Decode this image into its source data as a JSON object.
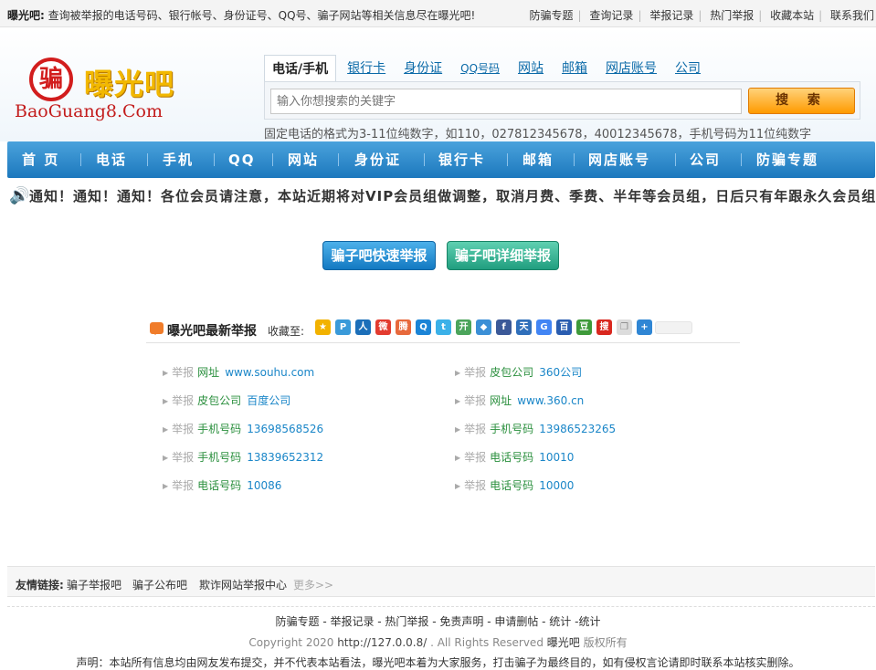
{
  "topbar": {
    "intro_bold": "曝光吧:",
    "intro_text": "查询被举报的电话号码、银行帐号、身份证号、QQ号、骗子网站等相关信息尽在曝光吧!",
    "links": [
      "防骗专题",
      "查询记录",
      "举报记录",
      "热门举报",
      "收藏本站",
      "联系我们"
    ]
  },
  "logo": {
    "badge": "骗",
    "name": "曝光吧",
    "domain": "BaoGuang8.Com"
  },
  "search": {
    "tabs": [
      "电话/手机",
      "银行卡",
      "身份证",
      "QQ号码",
      "网站",
      "邮箱",
      "网店账号",
      "公司"
    ],
    "active_tab": 0,
    "placeholder": "输入你想搜索的关键字",
    "button_label": "搜 索",
    "hint": "固定电话的格式为3-11位纯数字，如110，027812345678，40012345678，手机号码为11位纯数字"
  },
  "nav": {
    "items": [
      "首 页",
      "电话",
      "手机",
      "QQ",
      "网站",
      "身份证",
      "银行卡",
      "邮箱",
      "网店账号",
      "公司",
      "防骗专题"
    ]
  },
  "notice": {
    "text": "通知！通知！通知！各位会员请注意，本站近期将对VIP会员组做调整，取消月费、季费、半年等会员组，日后只有年跟永久会员组"
  },
  "actions": {
    "quick_report": "骗子吧快速举报",
    "detail_report": "骗子吧详细举报"
  },
  "latest": {
    "title": "曝光吧最新举报",
    "fav_label": "收藏至:",
    "share_icons": [
      "qzone-icon",
      "pengyou-icon",
      "renren-icon",
      "weibo-icon",
      "tencent-weibo-icon",
      "qq-friend-icon",
      "twitter-icon",
      "kaixin-icon",
      "douban-share-icon",
      "facebook-icon",
      "tianya-icon",
      "google-icon",
      "baidu-icon",
      "douban-icon",
      "sohu-icon",
      "copy-icon",
      "more-share-icon"
    ],
    "reports": [
      {
        "tag": "举报",
        "kind": "网址",
        "value": "www.souhu.com"
      },
      {
        "tag": "举报",
        "kind": "皮包公司",
        "value": "360公司"
      },
      {
        "tag": "举报",
        "kind": "皮包公司",
        "value": "百度公司"
      },
      {
        "tag": "举报",
        "kind": "网址",
        "value": "www.360.cn"
      },
      {
        "tag": "举报",
        "kind": "手机号码",
        "value": "13698568526"
      },
      {
        "tag": "举报",
        "kind": "手机号码",
        "value": "13986523265"
      },
      {
        "tag": "举报",
        "kind": "手机号码",
        "value": "13839652312"
      },
      {
        "tag": "举报",
        "kind": "电话号码",
        "value": "10010"
      },
      {
        "tag": "举报",
        "kind": "电话号码",
        "value": "10086"
      },
      {
        "tag": "举报",
        "kind": "电话号码",
        "value": "10000"
      }
    ]
  },
  "friends": {
    "label": "友情链接:",
    "links": [
      "骗子举报吧",
      "骗子公布吧",
      "欺诈网站举报中心"
    ],
    "more": "更多>>"
  },
  "footer": {
    "links": "防骗专题 - 举报记录 - 热门举报 - 免责声明 - 申请删帖 - 统计 -统计",
    "copyright_prefix": "Copyright 2020",
    "host": "http://127.0.0.8/",
    "rights": ". All Rights Reserved",
    "brand": "曝光吧",
    "owned": "版权所有",
    "disclaimer": "声明：本站所有信息均由网友发布提交，并不代表本站看法，曝光吧本着为大家服务，打击骗子为最终目的，如有侵权言论请即时联系本站核实删除。"
  },
  "colors": {
    "nav_blue": "#1c78bd",
    "search_orange": "#ff9a00",
    "report_green": "#2a8f3d",
    "report_link": "#1a86c8",
    "logo_red": "#d21d1d",
    "logo_gold": "#f2b800"
  }
}
